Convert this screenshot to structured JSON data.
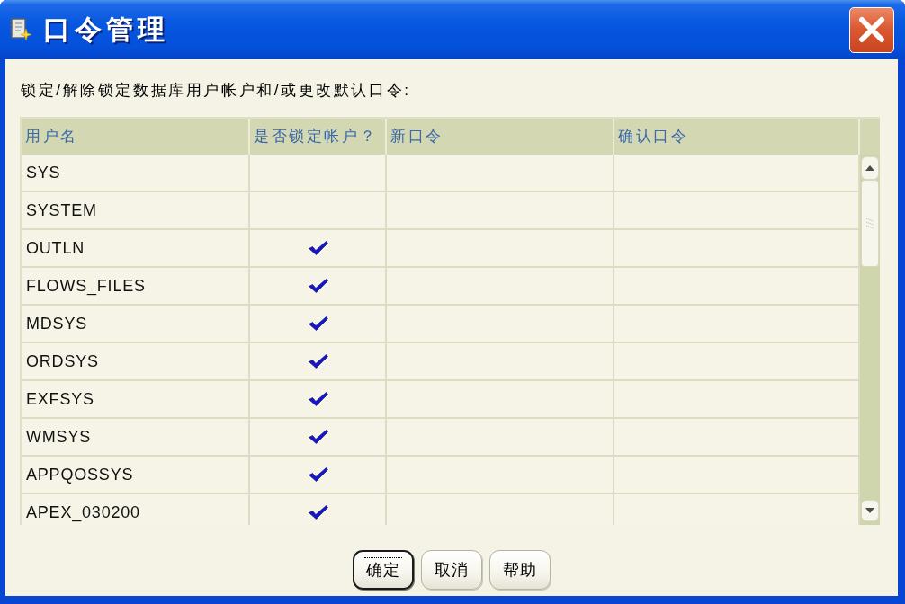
{
  "window": {
    "title": "口令管理"
  },
  "instruction": "锁定/解除锁定数据库用户帐户和/或更改默认口令:",
  "table": {
    "columns": [
      "用户名",
      "是否锁定帐户？",
      "新口令",
      "确认口令"
    ],
    "rows": [
      {
        "username": "SYS",
        "locked": false
      },
      {
        "username": "SYSTEM",
        "locked": false
      },
      {
        "username": "OUTLN",
        "locked": true
      },
      {
        "username": "FLOWS_FILES",
        "locked": true
      },
      {
        "username": "MDSYS",
        "locked": true
      },
      {
        "username": "ORDSYS",
        "locked": true
      },
      {
        "username": "EXFSYS",
        "locked": true
      },
      {
        "username": "WMSYS",
        "locked": true
      },
      {
        "username": "APPQOSSYS",
        "locked": true
      },
      {
        "username": "APEX_030200",
        "locked": true
      }
    ]
  },
  "buttons": [
    {
      "label": "确定",
      "default": true
    },
    {
      "label": "取消",
      "default": false
    },
    {
      "label": "帮助",
      "default": false
    }
  ]
}
